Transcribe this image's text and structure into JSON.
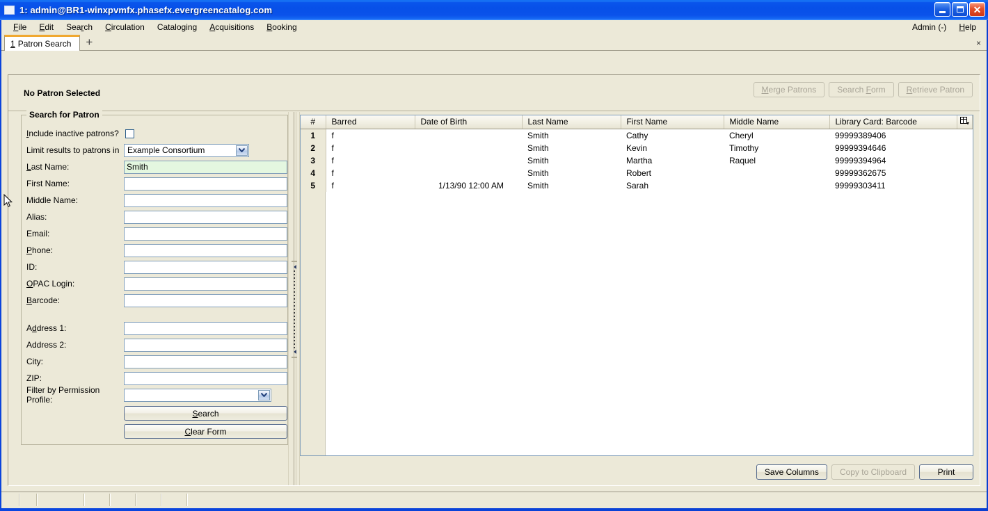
{
  "window": {
    "title": "1: admin@BR1-winxpvmfx.phasefx.evergreencatalog.com",
    "minimize_label": "",
    "maximize_label": "",
    "close_label": "✕"
  },
  "menubar": {
    "items": [
      {
        "label": "File",
        "accesskey": "F"
      },
      {
        "label": "Edit",
        "accesskey": "E"
      },
      {
        "label": "Search",
        "accesskey": "r"
      },
      {
        "label": "Circulation",
        "accesskey": "C"
      },
      {
        "label": "Cataloging",
        "accesskey": "g"
      },
      {
        "label": "Acquisitions",
        "accesskey": "A"
      },
      {
        "label": "Booking",
        "accesskey": "B"
      }
    ],
    "right": [
      {
        "label": "Admin (-)"
      },
      {
        "label": "Help",
        "accesskey": "H"
      }
    ]
  },
  "tabs": {
    "items": [
      {
        "number": "1",
        "label": "Patron Search",
        "active": true
      }
    ],
    "add_label": "+",
    "close_label": "×"
  },
  "patron_header": {
    "title": "No Patron Selected",
    "buttons": [
      {
        "label": "Merge Patrons",
        "disabled": true
      },
      {
        "label": "Search Form",
        "disabled": true
      },
      {
        "label": "Retrieve Patron",
        "disabled": true
      }
    ]
  },
  "search_form": {
    "legend": "Search for Patron",
    "fields": {
      "include_inactive": {
        "label": "Include inactive patrons?",
        "checked": false
      },
      "limit_results": {
        "label": "Limit results to patrons in",
        "value": "Example Consortium"
      },
      "last_name": {
        "label": "Last Name:",
        "value": "Smith",
        "focused": true
      },
      "first_name": {
        "label": "First Name:",
        "value": ""
      },
      "middle_name": {
        "label": "Middle Name:",
        "value": ""
      },
      "alias": {
        "label": "Alias:",
        "value": ""
      },
      "email": {
        "label": "Email:",
        "value": ""
      },
      "phone": {
        "label": "Phone:",
        "value": ""
      },
      "id": {
        "label": "ID:",
        "value": ""
      },
      "opac_login": {
        "label": "OPAC Login:",
        "value": ""
      },
      "barcode": {
        "label": "Barcode:",
        "value": ""
      },
      "address1": {
        "label": "Address 1:",
        "value": ""
      },
      "address2": {
        "label": "Address 2:",
        "value": ""
      },
      "city": {
        "label": "City:",
        "value": ""
      },
      "zip": {
        "label": "ZIP:",
        "value": ""
      },
      "permission_profile": {
        "label": "Filter by Permission Profile:",
        "value": ""
      }
    },
    "buttons": {
      "search": "Search",
      "clear": "Clear Form"
    }
  },
  "results": {
    "columns": [
      "#",
      "Barred",
      "Date of Birth",
      "Last Name",
      "First Name",
      "Middle Name",
      "Library Card: Barcode"
    ],
    "rows": [
      {
        "num": "1",
        "barred": "f",
        "dob": "",
        "last": "Smith",
        "first": "Cathy",
        "middle": "Cheryl",
        "barcode": "99999389406"
      },
      {
        "num": "2",
        "barred": "f",
        "dob": "",
        "last": "Smith",
        "first": "Kevin",
        "middle": "Timothy",
        "barcode": "99999394646"
      },
      {
        "num": "3",
        "barred": "f",
        "dob": "",
        "last": "Smith",
        "first": "Martha",
        "middle": "Raquel",
        "barcode": "99999394964"
      },
      {
        "num": "4",
        "barred": "f",
        "dob": "",
        "last": "Smith",
        "first": "Robert",
        "middle": "",
        "barcode": "99999362675"
      },
      {
        "num": "5",
        "barred": "f",
        "dob": "1/13/90 12:00 AM",
        "last": "Smith",
        "first": "Sarah",
        "middle": "",
        "barcode": "99999303411"
      }
    ],
    "buttons": [
      {
        "label": "Save Columns",
        "disabled": false
      },
      {
        "label": "Copy to Clipboard",
        "disabled": true
      },
      {
        "label": "Print",
        "disabled": false
      }
    ]
  },
  "colors": {
    "titlebar_blue": "#0a52ea",
    "window_bg": "#ece9d8",
    "tab_accent": "#f0a830",
    "field_border": "#7f9db9",
    "filled_field_bg": "#e4f7e0"
  }
}
